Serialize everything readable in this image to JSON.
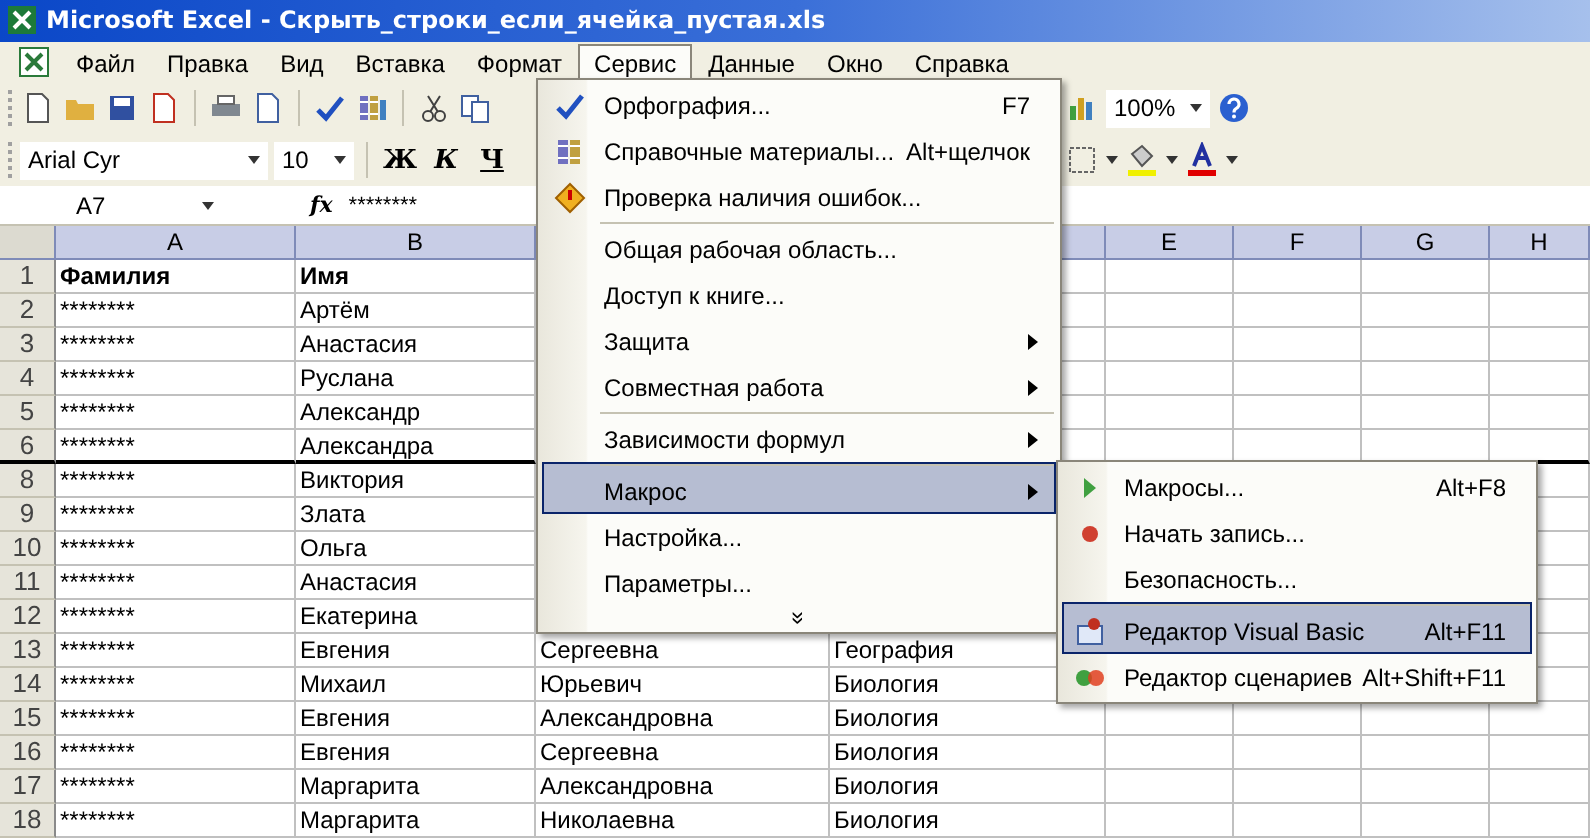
{
  "window": {
    "title": "Microsoft Excel - Скрыть_строки_если_ячейка_пустая.xls"
  },
  "menu_bar": [
    {
      "label": "Файл",
      "selected": false
    },
    {
      "label": "Правка",
      "selected": false
    },
    {
      "label": "Вид",
      "selected": false
    },
    {
      "label": "Вставка",
      "selected": false
    },
    {
      "label": "Формат",
      "selected": false
    },
    {
      "label": "Сервис",
      "selected": true
    },
    {
      "label": "Данные",
      "selected": false
    },
    {
      "label": "Окно",
      "selected": false
    },
    {
      "label": "Справка",
      "selected": false
    }
  ],
  "toolbar": {
    "zoom": "100%"
  },
  "format_toolbar": {
    "font": "Arial Cyr",
    "size": "10",
    "bold": "Ж",
    "italic": "К",
    "underline": "Ч"
  },
  "formula_bar": {
    "name_box": "A7",
    "fx": "fx",
    "value": "********"
  },
  "sheet": {
    "columns": [
      "A",
      "B",
      null,
      null,
      "E",
      "F",
      "G",
      "H"
    ],
    "rows": [
      {
        "number": "1",
        "cells": [
          "Фамилия",
          "Имя"
        ],
        "header": true,
        "border_below": false
      },
      {
        "number": "2",
        "cells": [
          "********",
          "Артём"
        ],
        "header": false,
        "border_below": false
      },
      {
        "number": "3",
        "cells": [
          "********",
          "Анастасия"
        ],
        "header": false,
        "border_below": false
      },
      {
        "number": "4",
        "cells": [
          "********",
          "Руслана"
        ],
        "header": false,
        "border_below": false
      },
      {
        "number": "5",
        "cells": [
          "********",
          "Александр"
        ],
        "header": false,
        "border_below": false
      },
      {
        "number": "6",
        "cells": [
          "********",
          "Александра"
        ],
        "header": false,
        "border_below": true
      },
      {
        "number": "8",
        "cells": [
          "********",
          "Виктория"
        ],
        "header": false,
        "border_below": false
      },
      {
        "number": "9",
        "cells": [
          "********",
          "Злата"
        ],
        "header": false,
        "border_below": false
      },
      {
        "number": "10",
        "cells": [
          "********",
          "Ольга"
        ],
        "header": false,
        "border_below": false
      },
      {
        "number": "11",
        "cells": [
          "********",
          "Анастасия"
        ],
        "header": false,
        "border_below": false
      },
      {
        "number": "12",
        "cells": [
          "********",
          "Екатерина"
        ],
        "header": false,
        "border_below": false
      },
      {
        "number": "13",
        "cells": [
          "********",
          "Евгения",
          "Сергеевна",
          "География"
        ],
        "header": false,
        "border_below": false
      },
      {
        "number": "14",
        "cells": [
          "********",
          "Михаил",
          "Юрьевич",
          "Биология"
        ],
        "header": false,
        "border_below": false
      },
      {
        "number": "15",
        "cells": [
          "********",
          "Евгения",
          "Александровна",
          "Биология"
        ],
        "header": false,
        "border_below": false
      },
      {
        "number": "16",
        "cells": [
          "********",
          "Евгения",
          "Сергеевна",
          "Биология"
        ],
        "header": false,
        "border_below": false
      },
      {
        "number": "17",
        "cells": [
          "********",
          "Маргарита",
          "Александровна",
          "Биология"
        ],
        "header": false,
        "border_below": false
      },
      {
        "number": "18",
        "cells": [
          "********",
          "Маргарита",
          "Николаевна",
          "Биология"
        ],
        "header": false,
        "border_below": false
      }
    ]
  },
  "tools_menu": {
    "items": [
      {
        "label": "Орфография...",
        "shortcut": "F7",
        "submenu": false,
        "selected": false,
        "separator_before": false
      },
      {
        "label": "Справочные материалы...",
        "shortcut": "Alt+щелчок",
        "submenu": false,
        "selected": false,
        "separator_before": false
      },
      {
        "label": "Проверка наличия ошибок...",
        "submenu": false,
        "selected": false,
        "separator_before": false
      },
      {
        "label": "Общая рабочая область...",
        "submenu": false,
        "selected": false,
        "separator_before": true
      },
      {
        "label": "Доступ к книге...",
        "submenu": false,
        "selected": false,
        "separator_before": false
      },
      {
        "label": "Защита",
        "submenu": true,
        "selected": false,
        "separator_before": false
      },
      {
        "label": "Совместная работа",
        "submenu": true,
        "selected": false,
        "separator_before": false
      },
      {
        "label": "Зависимости формул",
        "submenu": true,
        "selected": false,
        "separator_before": true
      },
      {
        "label": "Макрос",
        "submenu": true,
        "selected": true,
        "separator_before": true
      },
      {
        "label": "Настройка...",
        "submenu": false,
        "selected": false,
        "separator_before": false
      },
      {
        "label": "Параметры...",
        "submenu": false,
        "selected": false,
        "separator_before": false
      }
    ],
    "more": "»"
  },
  "macro_submenu": {
    "items": [
      {
        "label": "Макросы...",
        "shortcut": "Alt+F8",
        "selected": false,
        "separator_before": false
      },
      {
        "label": "Начать запись...",
        "selected": false,
        "separator_before": false
      },
      {
        "label": "Безопасность...",
        "selected": false,
        "separator_before": false
      },
      {
        "label": "Редактор Visual Basic",
        "shortcut": "Alt+F11",
        "selected": true,
        "separator_before": true
      },
      {
        "label": "Редактор сценариев",
        "shortcut": "Alt+Shift+F11",
        "selected": false,
        "separator_before": false
      }
    ]
  }
}
